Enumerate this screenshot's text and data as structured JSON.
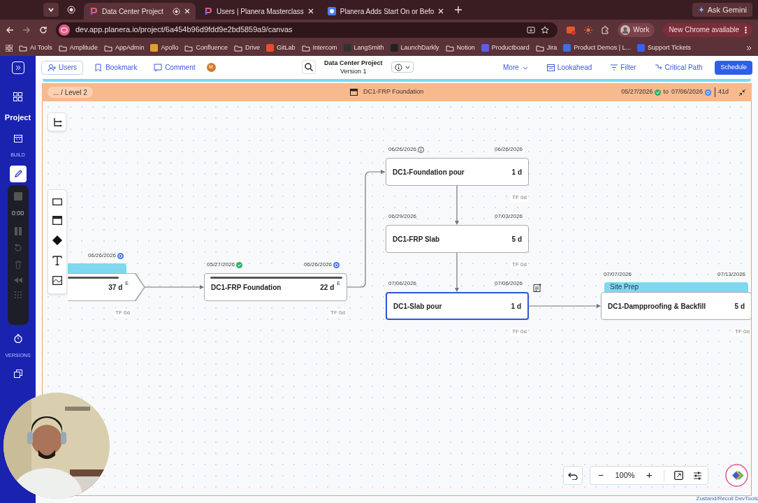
{
  "browser": {
    "tabs": [
      {
        "title": "Data Center Project",
        "selected": true
      },
      {
        "title": "Users | Planera Masterclass",
        "selected": false
      },
      {
        "title": "Planera Adds Start On or Befo",
        "selected": false
      }
    ],
    "ask_button": "Ask Gemini",
    "url": "dev.app.planera.io/project/6a454b96d9fdd9e2bd5859a9/canvas",
    "profile": "Work",
    "update_button": "New Chrome available",
    "bookmarks": [
      "AI Tools",
      "Amplitude",
      "AppAdmin",
      "Apollo",
      "Confluence",
      "Drive",
      "GitLab",
      "Intercom",
      "LangSmith",
      "LaunchDarkly",
      "Notion",
      "Productboard",
      "Jira",
      "Product Demos | L...",
      "Support Tickets"
    ]
  },
  "sidebar": {
    "project_label": "Project",
    "build_label": "BUILD",
    "recorder_time": "0:00",
    "versions_label": "VERSIONS"
  },
  "toolbar": {
    "left": [
      "Users",
      "Bookmark",
      "Comment"
    ],
    "avatar": "M",
    "project_title": "Data Center Project",
    "version": "Version 1",
    "right": [
      "More",
      "Lookahead",
      "Filter",
      "Critical Path"
    ],
    "schedule_button": "Schedule"
  },
  "level_bar": {
    "breadcrumb": "... / Level 2",
    "title": "DC1-FRP Foundation",
    "start": "05/27/2026",
    "to": "to",
    "end": "07/06/2026",
    "duration": "41d"
  },
  "nodes": [
    {
      "duration": "37 d",
      "flag": "E",
      "end": "06/26/2026",
      "float": "TF 0d",
      "selected": false,
      "kind": "summary"
    },
    {
      "name": "DC1-FRP Foundation",
      "duration": "22 d",
      "flag": "E",
      "start": "05/27/2026",
      "end": "06/26/2026",
      "float": "TF 0d",
      "selected": false,
      "kind": "summary"
    },
    {
      "name": "DC1-Foundation pour",
      "duration": "1 d",
      "start": "06/26/2026",
      "end": "06/26/2026",
      "float": "TF 0d",
      "selected": false,
      "kind": "task"
    },
    {
      "name": "DC1-FRP Slab",
      "duration": "5 d",
      "start": "06/29/2026",
      "end": "07/03/2026",
      "float": "TF 0d",
      "selected": false,
      "kind": "task"
    },
    {
      "name": "DC1-Slab pour",
      "duration": "1 d",
      "start": "07/06/2026",
      "end": "07/06/2026",
      "float": "TF 0d",
      "selected": true,
      "kind": "task"
    },
    {
      "name": "DC1-Dampproofing & Backfill",
      "duration": "5 d",
      "start": "07/07/2026",
      "end": "07/13/2026",
      "float": "TF 0d",
      "selected": false,
      "kind": "task",
      "group": "Site Prep"
    }
  ],
  "zoom": {
    "level": "100%",
    "minus": "−",
    "plus": "+"
  },
  "devtools_link": "Zustand/Recoil DevTools"
}
